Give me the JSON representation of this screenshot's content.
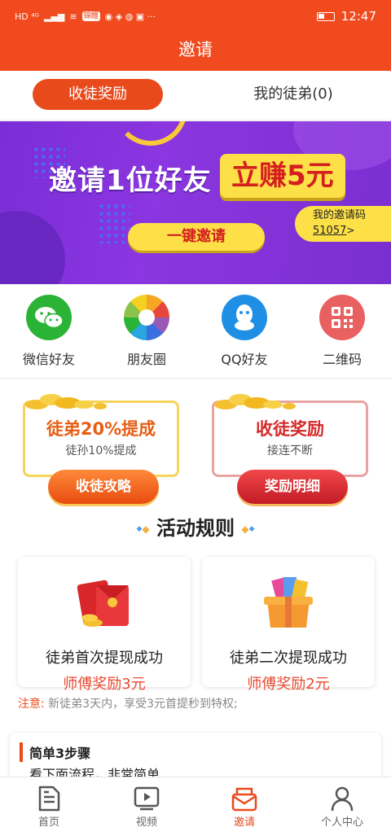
{
  "status_bar": {
    "time": "12:47",
    "left_text": "HD ⁴ᴳ",
    "chip": "锦鲤"
  },
  "app_bar": {
    "title": "邀请"
  },
  "tabs": {
    "active": "收徒奖励",
    "other": "我的徒弟(0)"
  },
  "banner": {
    "headline": "邀请1位好友",
    "reward": "立赚5元",
    "button": "一键邀请",
    "code_label": "我的邀请码",
    "code_value": "51057",
    "code_arrow": ">"
  },
  "share": [
    {
      "label": "微信好友",
      "icon": "wechat-icon",
      "color": "#2bb335"
    },
    {
      "label": "朋友圈",
      "icon": "moments-icon",
      "color": "#f5a623"
    },
    {
      "label": "QQ好友",
      "icon": "qq-icon",
      "color": "#1f8fe6"
    },
    {
      "label": "二维码",
      "icon": "qrcode-icon",
      "color": "#e86060"
    }
  ],
  "reward_cards": [
    {
      "title": "徒弟20%提成",
      "subtitle": "徒孙10%提成",
      "button": "收徒攻略"
    },
    {
      "title": "收徒奖励",
      "subtitle": "接连不断",
      "button": "奖励明细"
    }
  ],
  "rules": {
    "title": "活动规则",
    "cards": [
      {
        "line1": "徒弟首次提现成功",
        "line2": "师傅奖励3元"
      },
      {
        "line1": "徒弟二次提现成功",
        "line2": "师傅奖励2元"
      }
    ],
    "notice_label": "注意:",
    "notice_text": "新徒弟3天内，享受3元首提秒到特权;"
  },
  "steps": {
    "title": "简单3步骤",
    "subtitle": "看下面流程，非常简单"
  },
  "tabbar": [
    {
      "label": "首页",
      "icon": "home-document-icon"
    },
    {
      "label": "视频",
      "icon": "video-icon"
    },
    {
      "label": "邀请",
      "icon": "invite-envelope-icon"
    },
    {
      "label": "个人中心",
      "icon": "person-icon"
    }
  ],
  "colors": {
    "brand": "#f04a1e",
    "banner": "#8b36e0",
    "yellow": "#fde047"
  }
}
